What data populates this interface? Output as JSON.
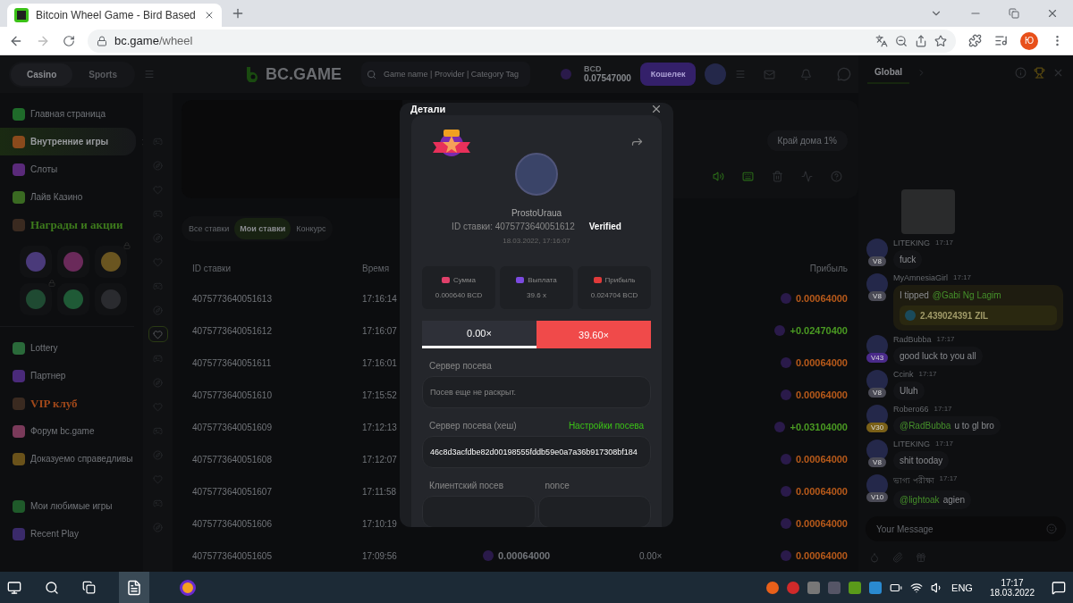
{
  "browser": {
    "tab_title": "Bitcoin Wheel Game - Bird Based",
    "url_host": "bc.game",
    "url_path": "/wheel",
    "profile_initial": "Ю"
  },
  "header": {
    "tabs": [
      {
        "label": "Casino",
        "selected": true
      },
      {
        "label": "Sports",
        "selected": false
      }
    ],
    "logo": "BC.GAME",
    "search_placeholder": "Game name | Provider | Category Tag",
    "currency": "BCD",
    "balance": "0.07547000",
    "wallet_button": "Кошелек"
  },
  "sidebar": {
    "items": [
      {
        "kind": "nav",
        "label": "Главная страница",
        "selected": false,
        "color": "#1f6b2a"
      },
      {
        "kind": "nav",
        "label": "Внутренние игры",
        "selected": true,
        "color": "#8a4a1c"
      },
      {
        "kind": "nav",
        "label": "Слоты",
        "selected": false,
        "color": "#5a2a7a"
      },
      {
        "kind": "nav",
        "label": "Лайв Казино",
        "selected": false,
        "color": "#3a6a22"
      },
      {
        "kind": "promo",
        "label": "Награды и акции",
        "color": "#3d7a1c"
      },
      {
        "kind": "rewards",
        "tiles": [
          {
            "locked": false,
            "color": "#4a3a7a"
          },
          {
            "locked": false,
            "color": "#6a2a5a"
          },
          {
            "locked": true,
            "color": "#6a5520"
          },
          {
            "locked": true,
            "color": "#1f4a32"
          },
          {
            "locked": false,
            "color": "#1f5a36"
          },
          {
            "locked": false,
            "color": "#2a2b2f"
          }
        ]
      },
      {
        "kind": "nav",
        "label": "Lottery",
        "selected": false,
        "color": "#2a6a3a"
      },
      {
        "kind": "nav",
        "label": "Партнер",
        "selected": false,
        "color": "#4a2a7a"
      },
      {
        "kind": "promo",
        "label": "VIP клуб",
        "color": "#a0481a"
      },
      {
        "kind": "nav",
        "label": "Форум bc.game",
        "selected": false,
        "color": "#7a3a5a"
      },
      {
        "kind": "nav",
        "label": "Доказуемо справедливы",
        "selected": false,
        "color": "#6a521a"
      },
      {
        "kind": "nav",
        "label": "Мои любимые игры",
        "selected": false,
        "color": "#1f5a2a"
      },
      {
        "kind": "nav",
        "label": "Recent Play",
        "selected": false,
        "color": "#3a2a6a"
      }
    ]
  },
  "rail": [
    {
      "selected": false
    },
    {
      "selected": false
    },
    {
      "selected": false
    },
    {
      "selected": false
    },
    {
      "selected": false
    },
    {
      "selected": false
    },
    {
      "selected": false
    },
    {
      "selected": false
    },
    {
      "selected": true
    },
    {
      "selected": false
    },
    {
      "selected": false
    },
    {
      "selected": false
    },
    {
      "selected": false
    },
    {
      "selected": false
    },
    {
      "selected": false
    },
    {
      "selected": false
    },
    {
      "selected": false
    }
  ],
  "game": {
    "house_edge": "Край дома 1%",
    "controls": [
      {
        "kind": "sound",
        "on": true
      },
      {
        "kind": "keyboard",
        "on": true
      },
      {
        "kind": "trash",
        "on": false
      },
      {
        "kind": "chart",
        "on": false
      },
      {
        "kind": "help",
        "on": false
      }
    ]
  },
  "bet_tabs": [
    {
      "label": "Все ставки",
      "selected": false
    },
    {
      "label": "Мои ставки",
      "selected": true
    },
    {
      "label": "Конкурс",
      "selected": false
    }
  ],
  "table": {
    "columns": [
      {
        "label": "ID ставки"
      },
      {
        "label": "Время"
      },
      {
        "label": "Прибыль"
      }
    ],
    "rows": [
      {
        "id": "4075773640051613",
        "time": "17:16:14",
        "profit": "0.00064000",
        "win": false
      },
      {
        "id": "4075773640051612",
        "time": "17:16:07",
        "profit": "+0.02470400",
        "win": true
      },
      {
        "id": "4075773640051611",
        "time": "17:16:01",
        "profit": "0.00064000",
        "win": false
      },
      {
        "id": "4075773640051610",
        "time": "17:15:52",
        "profit": "0.00064000",
        "win": false
      },
      {
        "id": "4075773640051609",
        "time": "17:12:13",
        "profit": "+0.03104000",
        "win": true
      },
      {
        "id": "4075773640051608",
        "time": "17:12:07",
        "profit": "0.00064000",
        "win": false
      },
      {
        "id": "4075773640051607",
        "time": "17:11:58",
        "profit": "0.00064000",
        "win": false
      },
      {
        "id": "4075773640051606",
        "time": "17:10:19",
        "profit": "0.00064000",
        "win": false
      },
      {
        "id": "4075773640051605",
        "time": "17:09:56",
        "bet": "0.00064000",
        "payout": "0.00×",
        "profit": "0.00064000",
        "win": false
      }
    ]
  },
  "chat": {
    "tab": "Global",
    "messages": [
      {
        "kind": "sticker"
      },
      {
        "kind": "text",
        "user": "LITEKING",
        "time": "17:17",
        "badge": "V8",
        "color": "#4a4a55",
        "text": "fuck"
      },
      {
        "kind": "tip",
        "user": "MyAmnesiaGirl",
        "time": "17:17",
        "badge": "V8",
        "color": "#4a4a55",
        "text": "I tipped",
        "mention": "@Gabi Ng Lagim",
        "amount": "2.439024391 ZIL"
      },
      {
        "kind": "text",
        "user": "RadBubba",
        "time": "17:17",
        "badge": "V43",
        "color": "#4a2a8a",
        "text": "good luck to you all"
      },
      {
        "kind": "text",
        "user": "Ccink",
        "time": "17:17",
        "badge": "V8",
        "color": "#4a4a55",
        "text": "Uluh"
      },
      {
        "kind": "text",
        "user": "Robero66",
        "time": "17:17",
        "badge": "V30",
        "color": "#7a6018",
        "mention": "@RadBubba",
        "text": "u to gl bro"
      },
      {
        "kind": "text",
        "user": "LITEKING",
        "time": "17:17",
        "badge": "V8",
        "color": "#4a4a55",
        "text": "shit tooday"
      },
      {
        "kind": "text",
        "user": "ভাগ্য পরীক্ষা",
        "time": "17:17",
        "badge": "V10",
        "color": "#4a4a55",
        "mention": "@lightoak",
        "text": "agien"
      }
    ],
    "input_placeholder": "Your Message"
  },
  "modal": {
    "title": "Детали",
    "player": "ProstoUraua",
    "bet_id": "ID ставки: 4075773640051612",
    "verified": "Verified",
    "date": "18.03.2022, 17:16:07",
    "stats": [
      {
        "label": "Сумма",
        "value": "0.000640 BCD",
        "color": "#e0406a"
      },
      {
        "label": "Выплата",
        "value": "39.6 x",
        "color": "#7b4ae0"
      },
      {
        "label": "Прибыль",
        "value": "0.024704 BCD",
        "color": "#e03a3a"
      }
    ],
    "segments": [
      {
        "label": "0.00×",
        "hit": false
      },
      {
        "label": "39.60×",
        "hit": true
      }
    ],
    "server_seed_label": "Сервер посева",
    "server_seed_value": "Посев еще не раскрыт.",
    "hash_label": "Сервер посева (хеш)",
    "seed_settings_link": "Настройки посева",
    "hash_value": "46c8d3acfdbe82d00198555fddb59e0a7a36b917308bf184",
    "client_seed_label": "Клиентский посев",
    "nonce_label": "nonce"
  },
  "taskbar": {
    "language": "ENG",
    "time": "17:17",
    "date": "18.03.2022"
  }
}
